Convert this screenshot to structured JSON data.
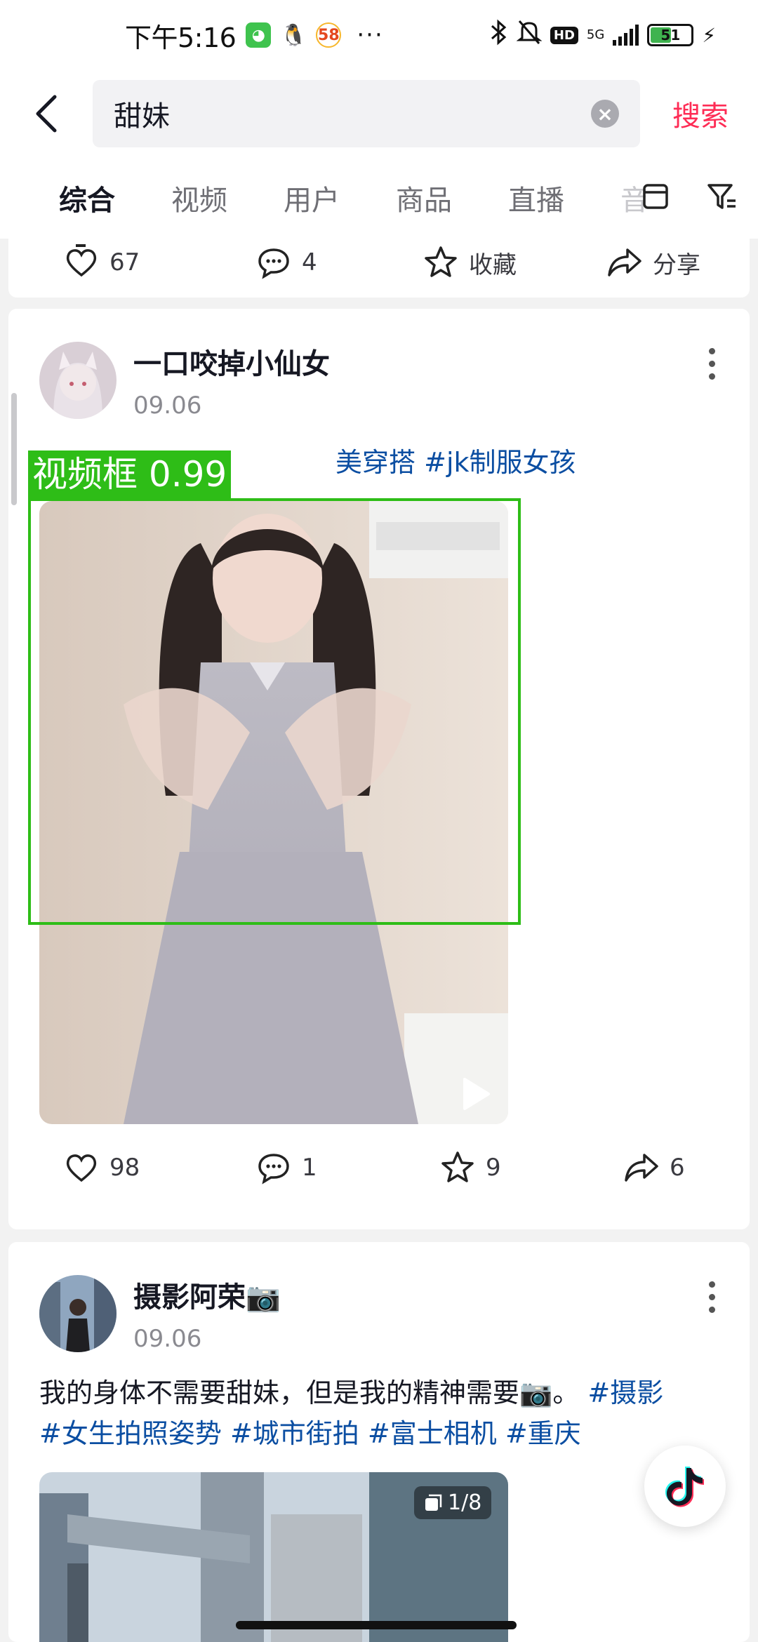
{
  "status_bar": {
    "time": "下午5:16",
    "app_58": "58",
    "more": "···",
    "hd": "HD",
    "network": "5G",
    "battery": "51"
  },
  "search": {
    "query": "甜妹",
    "submit_label": "搜索"
  },
  "tabs": [
    "综合",
    "视频",
    "用户",
    "商品",
    "直播",
    "音"
  ],
  "post_prev": {
    "likes": "67",
    "comments": "4",
    "favorite_label": "收藏",
    "share_label": "分享"
  },
  "post1": {
    "author": "一口咬掉小仙女",
    "date": "09.06",
    "caption_tags": [
      "美穿搭",
      "#jk制服女孩"
    ],
    "detect_label": "视频框 0.99",
    "likes": "98",
    "comments": "1",
    "favorites": "9",
    "shares": "6"
  },
  "post2": {
    "author": "摄影阿荣📷",
    "date": "09.06",
    "caption_text": "我的身体不需要甜妹，但是我的精神需要📷。",
    "tag_line1": "#摄影",
    "tags_line2": [
      "#女生拍照姿势",
      "#城市街拍",
      "#富士相机",
      "#重庆"
    ],
    "image_counter": "1/8"
  },
  "colors": {
    "accent": "#fe2c55",
    "hashtag": "#0b4ea2",
    "detect_box": "#2ebd17"
  }
}
